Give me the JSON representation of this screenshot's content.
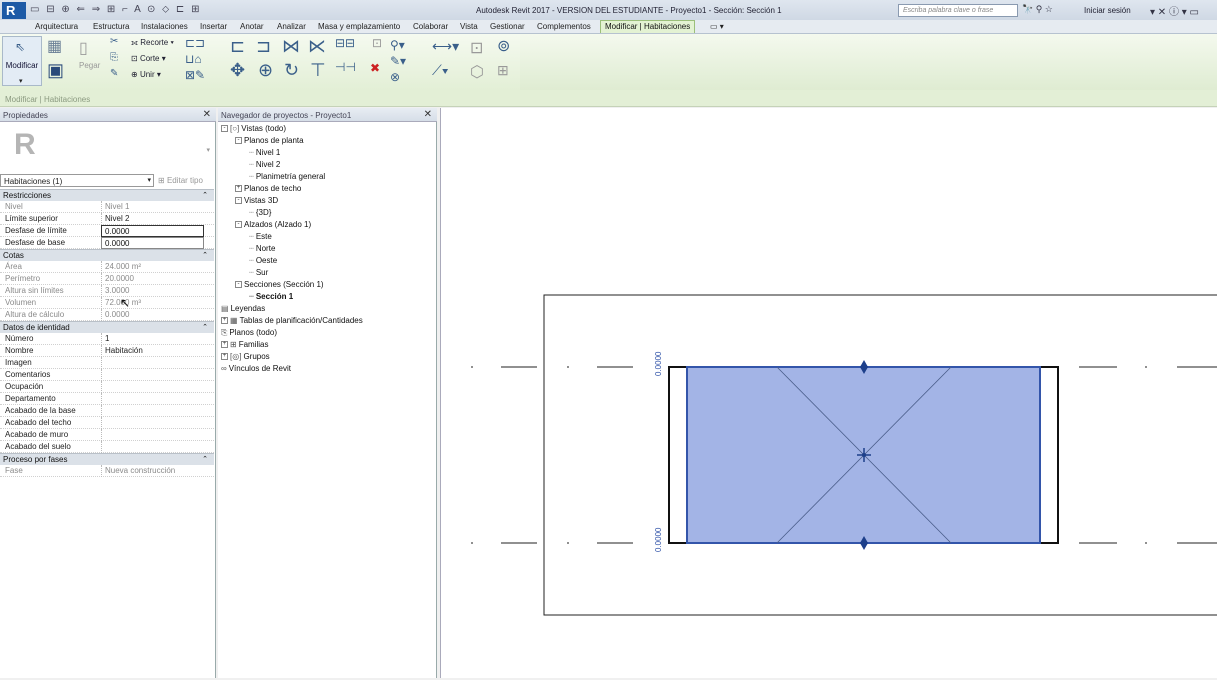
{
  "titlebar": {
    "logo": "R",
    "qat": "▭ ⊟ ⊕ ⇐ ⇒ ⊞ ⌐ A ⊙ ⬦ ⊏ ⊞",
    "app_title": "Autodesk Revit 2017 - VERSION DEL ESTUDIANTE -   Proyecto1 - Sección: Sección 1",
    "search_placeholder": "Escriba palabra clave o frase",
    "icons": "🔭 ⚲ ☆",
    "signin": "Iniciar sesión",
    "window_icons": "▾ ✕ ⓘ ▾ ▭"
  },
  "tabs": [
    "Arquitectura",
    "Estructura",
    "Instalaciones",
    "Insertar",
    "Anotar",
    "Analizar",
    "Masa y emplazamiento",
    "Colaborar",
    "Vista",
    "Gestionar",
    "Complementos",
    "Modificar | Habitaciones",
    "▭ ▾"
  ],
  "ribbon": {
    "modify": "Modificar",
    "paste": "Pegar",
    "cut": "Recorte",
    "corte": "Corte",
    "join": "Unir"
  },
  "optionsbar": {
    "label": "Modificar | Habitaciones"
  },
  "properties": {
    "header": "Propiedades",
    "type_selector": "Habitaciones (1)",
    "edit_type": "Editar tipo",
    "groups": [
      {
        "name": "Restricciones",
        "rows": [
          {
            "k": "Nivel",
            "v": "Nivel 1",
            "dim": true
          },
          {
            "k": "Límite superior",
            "v": "Nivel 2",
            "dim": false
          },
          {
            "k": "Desfase de límite",
            "v": "0.0000",
            "dim": false,
            "edit": true
          },
          {
            "k": "Desfase de base",
            "v": "0.0000",
            "dim": false,
            "edit": true
          }
        ]
      },
      {
        "name": "Cotas",
        "rows": [
          {
            "k": "Área",
            "v": "24.000 m²",
            "dim": true
          },
          {
            "k": "Perímetro",
            "v": "20.0000",
            "dim": true
          },
          {
            "k": "Altura sin límites",
            "v": "3.0000",
            "dim": true
          },
          {
            "k": "Volumen",
            "v": "72.000 m³",
            "dim": true
          },
          {
            "k": "Altura de cálculo",
            "v": "0.0000",
            "dim": true
          }
        ]
      },
      {
        "name": "Datos de identidad",
        "rows": [
          {
            "k": "Número",
            "v": "1",
            "dim": false
          },
          {
            "k": "Nombre",
            "v": "Habitación",
            "dim": false
          },
          {
            "k": "Imagen",
            "v": "",
            "dim": false
          },
          {
            "k": "Comentarios",
            "v": "",
            "dim": false
          },
          {
            "k": "Ocupación",
            "v": "",
            "dim": false
          },
          {
            "k": "Departamento",
            "v": "",
            "dim": false
          },
          {
            "k": "Acabado de la base",
            "v": "",
            "dim": false
          },
          {
            "k": "Acabado del techo",
            "v": "",
            "dim": false
          },
          {
            "k": "Acabado de muro",
            "v": "",
            "dim": false
          },
          {
            "k": "Acabado del suelo",
            "v": "",
            "dim": false
          }
        ]
      },
      {
        "name": "Proceso por fases",
        "rows": [
          {
            "k": "Fase",
            "v": "Nueva construcción",
            "dim": true
          }
        ]
      }
    ]
  },
  "browser": {
    "header": "Navegador de proyectos - Proyecto1",
    "nodes": [
      {
        "text": "Vistas (todo)",
        "level": 0,
        "exp": "-",
        "icon": "[○]",
        "bold": false
      },
      {
        "text": "Planos de planta",
        "level": 1,
        "exp": "-",
        "icon": "",
        "bold": false
      },
      {
        "text": "Nivel 1",
        "level": 2,
        "exp": "",
        "icon": "",
        "bold": false
      },
      {
        "text": "Nivel 2",
        "level": 2,
        "exp": "",
        "icon": "",
        "bold": false
      },
      {
        "text": "Planimetría general",
        "level": 2,
        "exp": "",
        "icon": "",
        "bold": false
      },
      {
        "text": "Planos de techo",
        "level": 1,
        "exp": "+",
        "icon": "",
        "bold": false
      },
      {
        "text": "Vistas 3D",
        "level": 1,
        "exp": "-",
        "icon": "",
        "bold": false
      },
      {
        "text": "{3D}",
        "level": 2,
        "exp": "",
        "icon": "",
        "bold": false
      },
      {
        "text": "Alzados (Alzado 1)",
        "level": 1,
        "exp": "-",
        "icon": "",
        "bold": false
      },
      {
        "text": "Este",
        "level": 2,
        "exp": "",
        "icon": "",
        "bold": false
      },
      {
        "text": "Norte",
        "level": 2,
        "exp": "",
        "icon": "",
        "bold": false
      },
      {
        "text": "Oeste",
        "level": 2,
        "exp": "",
        "icon": "",
        "bold": false
      },
      {
        "text": "Sur",
        "level": 2,
        "exp": "",
        "icon": "",
        "bold": false
      },
      {
        "text": "Secciones (Sección 1)",
        "level": 1,
        "exp": "-",
        "icon": "",
        "bold": false
      },
      {
        "text": "Sección 1",
        "level": 2,
        "exp": "",
        "icon": "",
        "bold": true
      },
      {
        "text": "Leyendas",
        "level": 0,
        "exp": "",
        "icon": "▤",
        "bold": false
      },
      {
        "text": "Tablas de planificación/Cantidades",
        "level": 0,
        "exp": "+",
        "icon": "▦",
        "bold": false
      },
      {
        "text": "Planos (todo)",
        "level": 0,
        "exp": "",
        "icon": "⎘",
        "bold": false
      },
      {
        "text": "Familias",
        "level": 0,
        "exp": "+",
        "icon": "⊞",
        "bold": false
      },
      {
        "text": "Grupos",
        "level": 0,
        "exp": "+",
        "icon": "[◎]",
        "bold": false
      },
      {
        "text": "Vínculos de Revit",
        "level": 0,
        "exp": "",
        "icon": "∞",
        "bold": false
      }
    ]
  },
  "canvas": {
    "level_top_value": "0.0000",
    "level_bottom_value": "0.0000",
    "room_fill": "#a3b4e6",
    "room_edge": "#3355aa"
  }
}
